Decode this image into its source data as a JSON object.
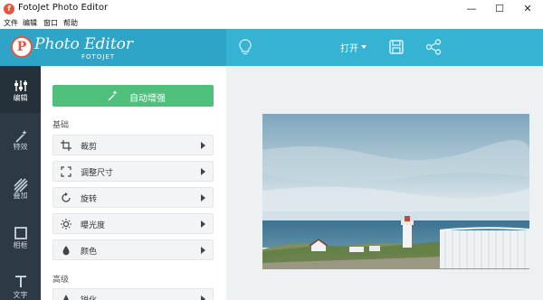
{
  "window": {
    "title": "FotoJet Photo Editor",
    "app_icon_letter": "f"
  },
  "window_controls": {
    "minimize": "—",
    "maximize": "☐",
    "close": "✕"
  },
  "menu": [
    "文件",
    "编辑",
    "窗口",
    "帮助"
  ],
  "header": {
    "logo_letter": "P",
    "logo_text": "Photo Editor",
    "logo_sub": "FOTOJET",
    "open_label": "打开",
    "accent_color": "#36b3d3"
  },
  "rail": [
    {
      "label": "编辑",
      "icon": "sliders-icon"
    },
    {
      "label": "特效",
      "icon": "magic-wand-icon"
    },
    {
      "label": "叠加",
      "icon": "overlay-icon"
    },
    {
      "label": "相框",
      "icon": "frame-icon"
    },
    {
      "label": "文字",
      "icon": "text-icon"
    }
  ],
  "panel": {
    "auto_enhance": "自动增强",
    "section_basic": "基础",
    "basic_items": [
      {
        "label": "裁剪",
        "icon": "crop-icon"
      },
      {
        "label": "调整尺寸",
        "icon": "resize-icon"
      },
      {
        "label": "旋转",
        "icon": "rotate-icon"
      },
      {
        "label": "曝光度",
        "icon": "exposure-icon"
      },
      {
        "label": "颜色",
        "icon": "color-drop-icon"
      }
    ],
    "section_advanced": "高级",
    "advanced_items": [
      {
        "label": "锐化",
        "icon": "sharpen-icon"
      }
    ]
  }
}
